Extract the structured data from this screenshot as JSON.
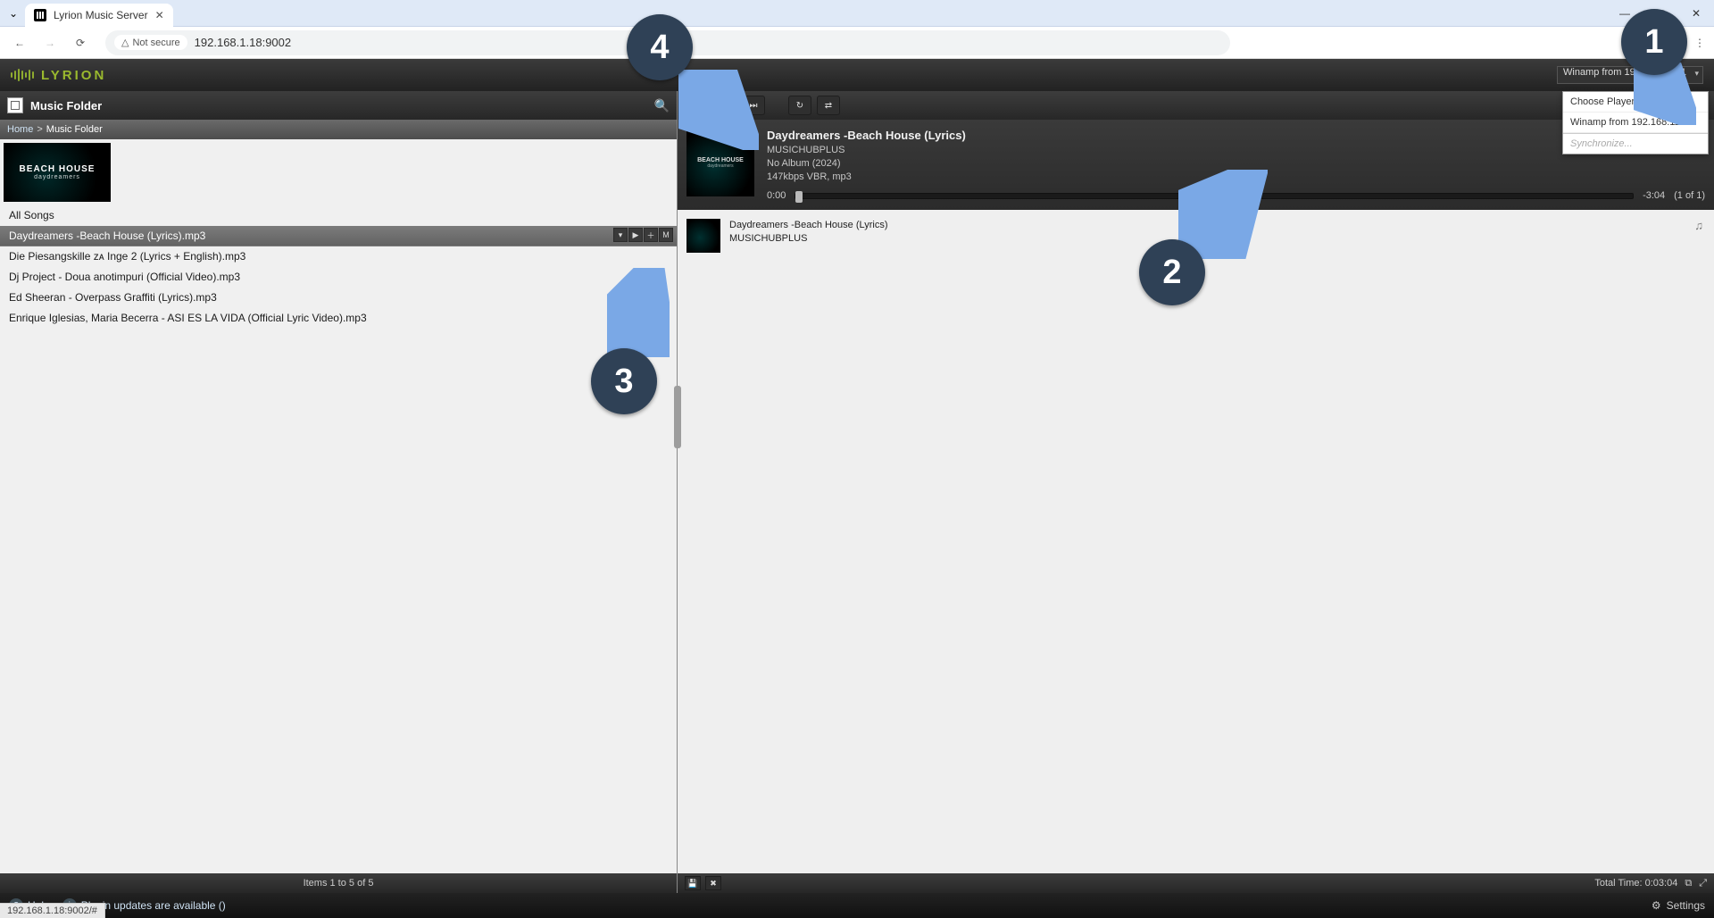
{
  "browser": {
    "tab_title": "Lyrion Music Server",
    "url": "192.168.1.18:9002",
    "security_label": "Not secure",
    "status_url": "192.168.1.18:9002/#"
  },
  "brand": "LYRION",
  "player_selector": "Winamp from 192.168.112.1",
  "player_menu": {
    "choose": "Choose Player",
    "item1": "Winamp from 192.168.112.1",
    "sync": "Synchronize..."
  },
  "left": {
    "title": "Music Folder",
    "crumb_home": "Home",
    "crumb_current": "Music Folder",
    "album_art_line1": "BEACH HOUSE",
    "album_art_line2": "daydreamers",
    "all_songs": "All Songs",
    "songs": [
      "Daydreamers -Beach House (Lyrics).mp3",
      "Die Piesangskille ᴢᴀ Inge 2 (Lyrics + English).mp3",
      "Dj Project - Doua anotimpuri (Official Video).mp3",
      "Ed Sheeran - Overpass Graffiti (Lyrics).mp3",
      "Enrique Iglesias, Maria Becerra - ASI ES LA VIDA (Official Lyric Video).mp3"
    ],
    "footer": "Items 1 to 5 of 5"
  },
  "now_playing": {
    "title": "Daydreamers -Beach House (Lyrics)",
    "artist": "MUSICHUBPLUS",
    "album": "No Album (2024)",
    "format": "147kbps VBR, mp3",
    "elapsed": "0:00",
    "remaining": "-3:04",
    "index": "(1 of 1)"
  },
  "queue": [
    {
      "title": "Daydreamers -Beach House (Lyrics)",
      "artist": "MUSICHUBPLUS"
    }
  ],
  "right_footer": {
    "total_time_label": "Total Time: 0:03:04"
  },
  "bottom": {
    "help": "Help",
    "plugin": "Plugin updates are available ()",
    "settings": "Settings"
  },
  "callouts": {
    "b1": "1",
    "b2": "2",
    "b3": "3",
    "b4": "4"
  }
}
